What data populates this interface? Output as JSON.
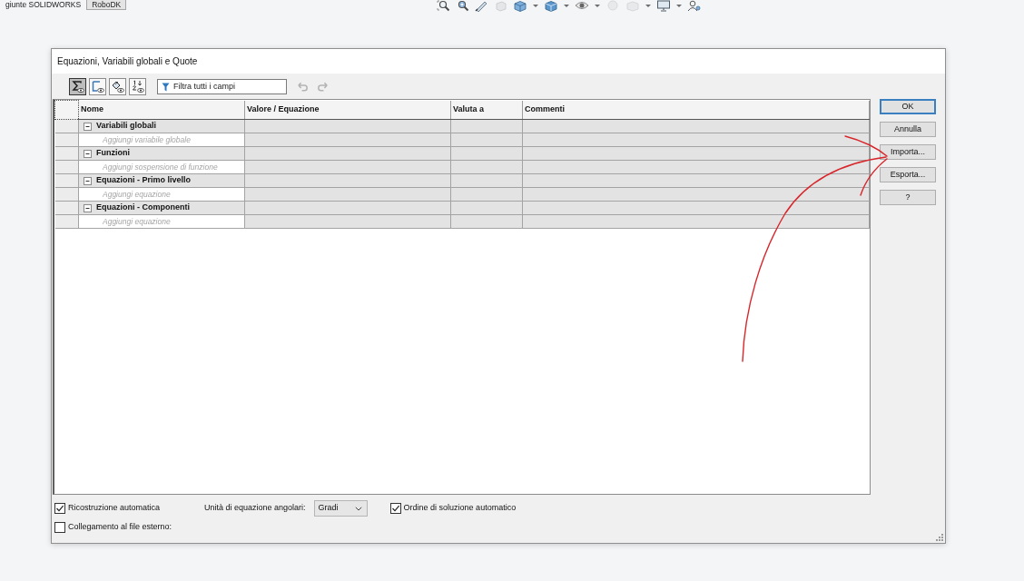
{
  "app_tabs": [
    {
      "label": "giunte SOLIDWORKS",
      "selected": false
    },
    {
      "label": "RoboDK",
      "selected": false
    }
  ],
  "dialog": {
    "title": "Equazioni, Variabili globali e Quote",
    "view_buttons": [
      {
        "kind": "equations",
        "selected": true
      },
      {
        "kind": "sheet",
        "selected": false
      },
      {
        "kind": "sketch",
        "selected": false
      },
      {
        "kind": "ordered",
        "selected": false
      }
    ],
    "filter": {
      "placeholder": "Filtra tutti i campi"
    },
    "history_buttons": [
      {
        "kind": "undo",
        "disabled": true
      },
      {
        "kind": "redo",
        "disabled": true
      }
    ],
    "table": {
      "columns": [
        "Nome",
        "Valore / Equazione",
        "Valuta a",
        "Commenti"
      ],
      "groups": [
        {
          "name": "Variabili globali",
          "expanded": true,
          "add_row": {
            "placeholder": "Aggiungi variabile globale"
          }
        },
        {
          "name": "Funzioni",
          "expanded": true,
          "add_row": {
            "placeholder": "Aggiungi sospensione di funzione"
          }
        },
        {
          "name": "Equazioni - Primo livello",
          "expanded": true,
          "add_row": {
            "placeholder": "Aggiungi equazione"
          }
        },
        {
          "name": "Equazioni - Componenti",
          "expanded": true,
          "add_row": {
            "placeholder": "Aggiungi equazione"
          }
        }
      ]
    },
    "buttons": [
      {
        "label": "OK",
        "default": true
      },
      {
        "label": "Annulla",
        "default": false
      },
      {
        "label": "Importa...",
        "default": false
      },
      {
        "label": "Esporta...",
        "default": false
      },
      {
        "label": "?",
        "default": false
      }
    ],
    "options": {
      "auto_rebuild": {
        "label": "Ricostruzione automatica",
        "checked": true
      },
      "angle_units": {
        "label": "Unità di equazione angolari:",
        "value": "Gradi"
      },
      "auto_solve_order": {
        "label": "Ordine di soluzione automatico",
        "checked": true
      },
      "external_link": {
        "label": "Collegamento al file esterno:",
        "checked": false
      }
    }
  }
}
